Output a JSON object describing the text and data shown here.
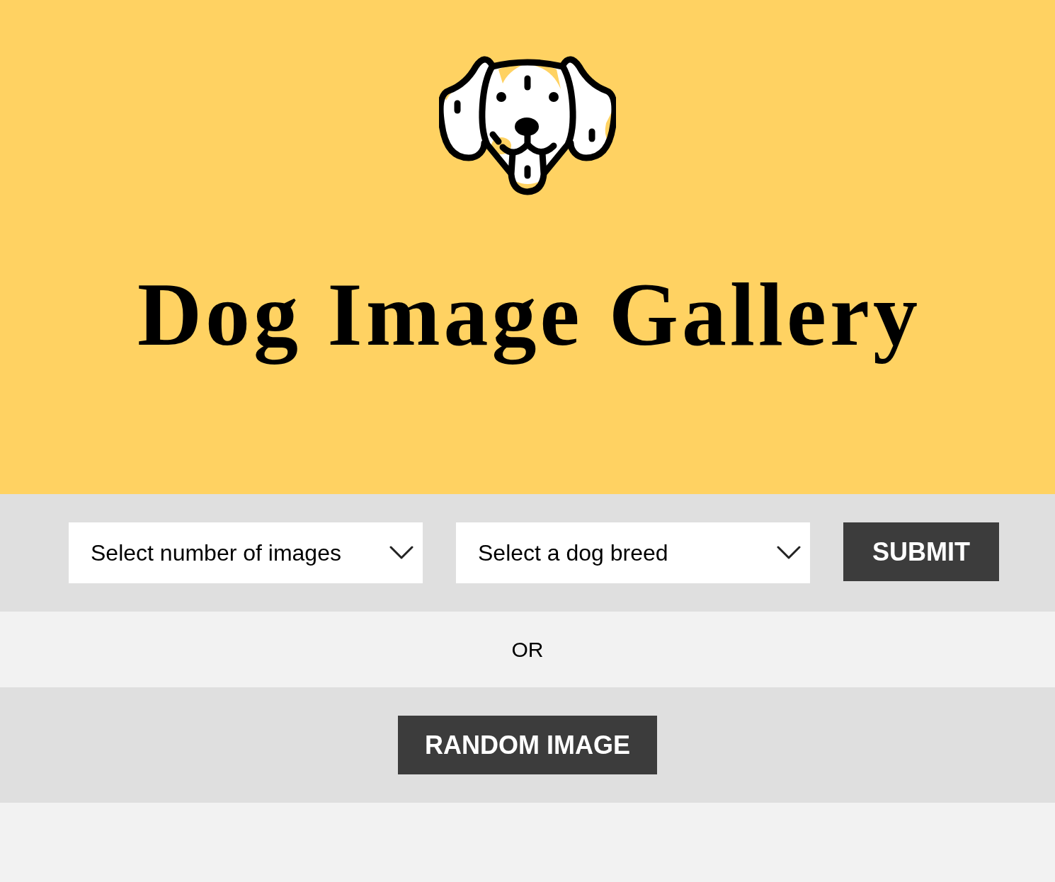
{
  "header": {
    "title": "Dog Image Gallery"
  },
  "filters": [
    {
      "kind": "select",
      "value": "Select number of images"
    },
    {
      "kind": "select",
      "value": "Select a dog breed"
    },
    {
      "kind": "button",
      "label": "SUBMIT"
    }
  ],
  "separator": "OR",
  "random_button": {
    "label": "RANDOM IMAGE"
  }
}
